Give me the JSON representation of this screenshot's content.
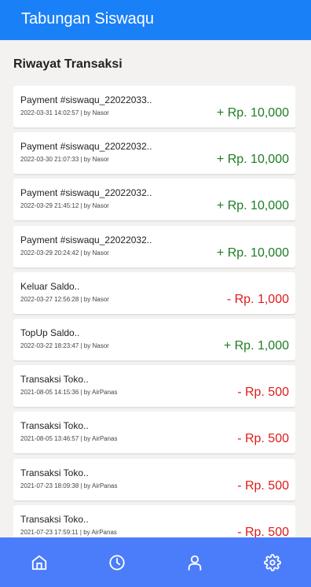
{
  "app": {
    "title": "Tabungan Siswaqu"
  },
  "section": {
    "title": "Riwayat Transaksi"
  },
  "colors": {
    "primary": "#1a80f8",
    "nav": "#4b7dfa",
    "credit": "#1e7d23",
    "debit": "#e01b1b"
  },
  "transactions": [
    {
      "title": "Payment #siswaqu_22022033..",
      "meta": "2022-03-31 14:02:57 | by Nasor",
      "amount": "+ Rp. 10,000",
      "type": "credit"
    },
    {
      "title": "Payment #siswaqu_22022032..",
      "meta": "2022-03-30 21:07:33 | by Nasor",
      "amount": "+ Rp. 10,000",
      "type": "credit"
    },
    {
      "title": "Payment #siswaqu_22022032..",
      "meta": "2022-03-29 21:45:12 | by Nasor",
      "amount": "+ Rp. 10,000",
      "type": "credit"
    },
    {
      "title": "Payment #siswaqu_22022032..",
      "meta": "2022-03-29 20:24:42 | by Nasor",
      "amount": "+ Rp. 10,000",
      "type": "credit"
    },
    {
      "title": "Keluar Saldo..",
      "meta": "2022-03-27 12:56:28 | by Nasor",
      "amount": "- Rp. 1,000",
      "type": "debit"
    },
    {
      "title": "TopUp Saldo..",
      "meta": "2022-03-22 18:23:47 | by Nasor",
      "amount": "+ Rp. 1,000",
      "type": "credit"
    },
    {
      "title": "Transaksi Toko..",
      "meta": "2021-08-05 14:15:36 | by AirPanas",
      "amount": "- Rp. 500",
      "type": "debit"
    },
    {
      "title": "Transaksi Toko..",
      "meta": "2021-08-05 13:46:57 | by AirPanas",
      "amount": "- Rp. 500",
      "type": "debit"
    },
    {
      "title": "Transaksi Toko..",
      "meta": "2021-07-23 18:09:38 | by AirPanas",
      "amount": "- Rp. 500",
      "type": "debit"
    },
    {
      "title": "Transaksi Toko..",
      "meta": "2021-07-23 17:59:11 | by AirPanas",
      "amount": "- Rp. 500",
      "type": "debit"
    }
  ],
  "nav": [
    {
      "name": "home-icon"
    },
    {
      "name": "clock-icon"
    },
    {
      "name": "user-icon"
    },
    {
      "name": "gear-icon"
    }
  ]
}
